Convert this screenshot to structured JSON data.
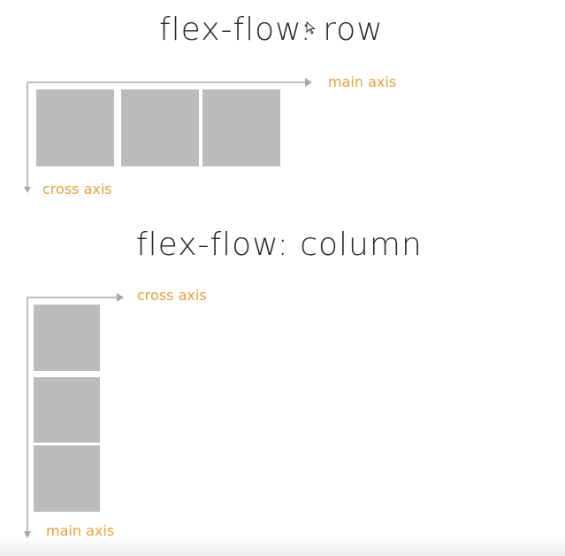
{
  "row_diagram": {
    "title": "flex-flow: row",
    "main_axis_label": "main axis",
    "cross_axis_label": "cross axis",
    "item_count": 3
  },
  "column_diagram": {
    "title": "flex-flow: column",
    "cross_axis_label": "cross axis",
    "main_axis_label": "main axis",
    "item_count": 3
  },
  "colors": {
    "axis_label": "#e5a13a",
    "axis_line": "#a8a8a8",
    "box_fill": "#bcbcbc",
    "title_text": "#2a2a2a"
  }
}
